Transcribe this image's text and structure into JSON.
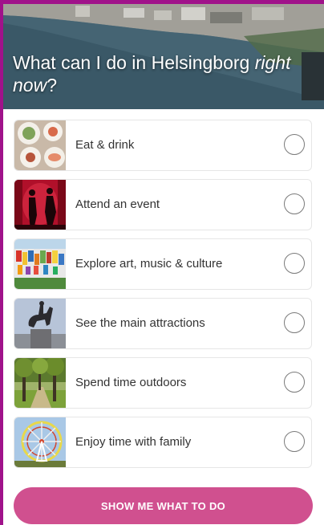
{
  "hero": {
    "title_main": "What can I do in Helsingborg ",
    "title_emphasis": "right now",
    "title_end": "?"
  },
  "options": [
    {
      "label": "Eat & drink",
      "icon": "food-plates-photo",
      "selected": false
    },
    {
      "label": "Attend an event",
      "icon": "stage-performers-photo",
      "selected": false
    },
    {
      "label": "Explore art, music & culture",
      "icon": "colorful-building-photo",
      "selected": false
    },
    {
      "label": "See the main attractions",
      "icon": "equestrian-statue-photo",
      "selected": false
    },
    {
      "label": "Spend time outdoors",
      "icon": "park-trees-photo",
      "selected": false
    },
    {
      "label": "Enjoy time with family",
      "icon": "ferris-wheel-photo",
      "selected": false
    }
  ],
  "cta": {
    "label": "SHOW ME WHAT TO DO",
    "color": "#d0508f"
  },
  "colors": {
    "frame": "#a0128a",
    "text": "#333333"
  }
}
